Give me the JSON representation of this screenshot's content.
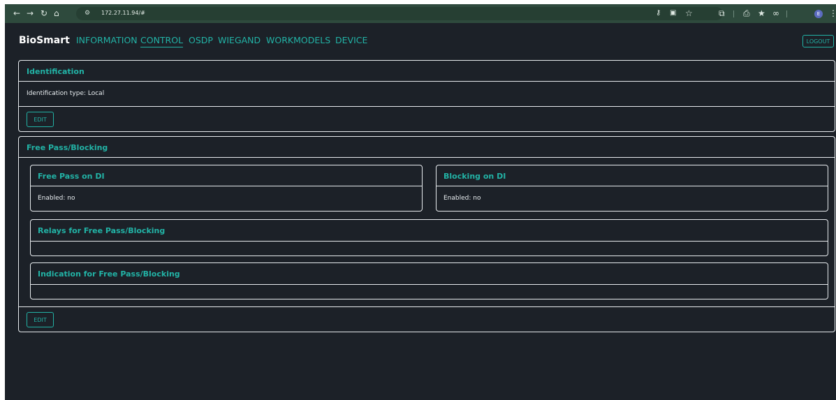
{
  "browser": {
    "url": "172.27.11.94/#",
    "profile_initial": "E",
    "icons": [
      "back-arrow-icon",
      "forward-arrow-icon",
      "reload-icon",
      "home-icon",
      "site-settings-icon",
      "password-key-icon",
      "translate-icon",
      "bookmark-star-icon",
      "extensions-icon",
      "print-icon",
      "bookmarks-icon",
      "link-icon",
      "menu-icon"
    ]
  },
  "header": {
    "brand": "BioSmart",
    "nav": [
      "INFORMATION",
      "CONTROL",
      "OSDP",
      "WIEGAND",
      "WORKMODELS",
      "DEVICE"
    ],
    "active_nav": "CONTROL",
    "logout_label": "LOGOUT"
  },
  "identification": {
    "title": "Identification",
    "type_text": "Identification type: Local",
    "edit_label": "EDIT"
  },
  "free_pass": {
    "title": "Free Pass/Blocking",
    "free_pass_di": {
      "title": "Free Pass on DI",
      "status": "Enabled: no"
    },
    "blocking_di": {
      "title": "Blocking on DI",
      "status": "Enabled: no"
    },
    "relays": {
      "title": "Relays for Free Pass/Blocking"
    },
    "indication": {
      "title": "Indication for Free Pass/Blocking"
    },
    "edit_label": "EDIT"
  },
  "colors": {
    "accent": "#22b3a6",
    "background": "#1c2128",
    "browser_bar": "#2e4a3d"
  }
}
